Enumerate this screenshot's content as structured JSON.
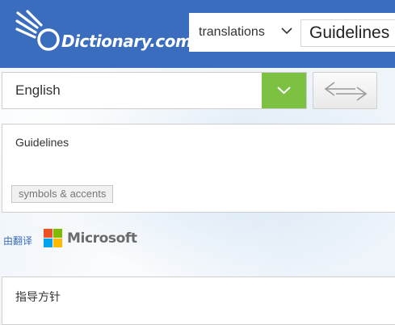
{
  "header": {
    "logo_text": "Dictionary.com",
    "search_type": "translations",
    "search_value": "Guidelines"
  },
  "translator": {
    "language": "English",
    "source_text": "Guidelines",
    "symbols_label": "symbols & accents",
    "powered_by": "由翻译",
    "provider": "Microsoft",
    "result_text": "指导方针"
  },
  "colors": {
    "header_blue": "#3a6dbe",
    "dropdown_green": "#7cc142"
  }
}
